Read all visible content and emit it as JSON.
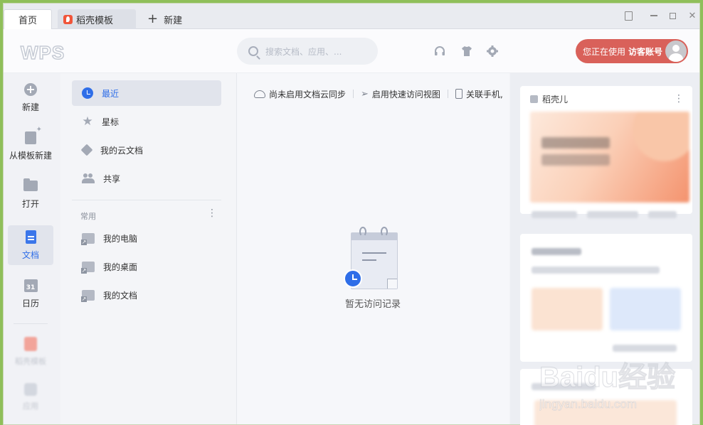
{
  "tabs": [
    {
      "label": "首页"
    },
    {
      "label": "稻壳模板"
    },
    {
      "label": "新建"
    }
  ],
  "header": {
    "logo": "WPS",
    "search_placeholder": "搜索文档、应用、...",
    "account_prefix": "您正在使用",
    "account_name": "访客账号"
  },
  "rail": {
    "items": [
      {
        "label": "新建",
        "icon": "plus-circle-icon"
      },
      {
        "label": "从模板新建",
        "icon": "template-icon"
      },
      {
        "label": "打开",
        "icon": "folder-open-icon"
      },
      {
        "label": "文档",
        "icon": "document-icon",
        "active": true
      },
      {
        "label": "日历",
        "icon": "calendar-icon",
        "badge": "31"
      }
    ],
    "blurred": [
      {
        "label": "稻壳模板"
      },
      {
        "label": "应用"
      }
    ]
  },
  "nav": {
    "items": [
      {
        "label": "最近",
        "icon": "clock-icon",
        "active": true
      },
      {
        "label": "星标",
        "icon": "star-icon"
      },
      {
        "label": "我的云文档",
        "icon": "cloud-cube-icon"
      },
      {
        "label": "共享",
        "icon": "people-icon"
      }
    ],
    "section_title": "常用",
    "common": [
      {
        "label": "我的电脑"
      },
      {
        "label": "我的桌面"
      },
      {
        "label": "我的文档"
      }
    ]
  },
  "main": {
    "toolbar": [
      {
        "label": "尚未启用文档云同步",
        "icon": "cloud-icon"
      },
      {
        "label": "启用快速访问视图",
        "icon": "paper-plane-icon"
      },
      {
        "label": "关联手机,",
        "icon": "phone-icon"
      }
    ],
    "empty_text": "暂无访问记录"
  },
  "right_panel": {
    "card_title": "稻壳儿"
  },
  "colors": {
    "accent": "#2f6ee8",
    "account_button": "#d9615a",
    "window_border": "#8fbf5a"
  },
  "watermark": {
    "brand": "Baidu经验",
    "url": "jingyan.baidu.com"
  }
}
